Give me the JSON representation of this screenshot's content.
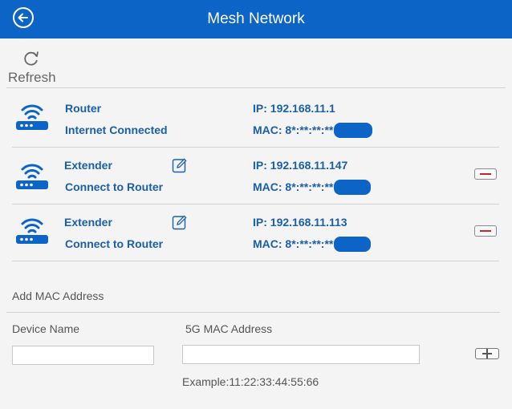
{
  "header": {
    "title": "Mesh Network"
  },
  "toolbar": {
    "refresh_label": "Refresh"
  },
  "devices": [
    {
      "type": "Router",
      "status": "Internet Connected",
      "ip": "IP: 192.168.11.1",
      "mac": "MAC: 8*:**:**:**:"
    },
    {
      "type": "Extender",
      "status": "Connect to Router",
      "ip": "IP: 192.168.11.147",
      "mac": "MAC: 8*:**:**:**:"
    },
    {
      "type": "Extender",
      "status": "Connect to Router",
      "ip": "IP: 192.168.11.113",
      "mac": "MAC: 8*:**:**:**:"
    }
  ],
  "add_mac": {
    "section_title": "Add MAC Address",
    "device_name_label": "Device Name",
    "mac_label": "5G MAC Address",
    "device_name_value": "",
    "mac_value": "",
    "example": "Example:11:22:33:44:55:66"
  },
  "colors": {
    "header": "#0b64c6",
    "text_accent": "#1a5fa8",
    "remove": "#c62828"
  },
  "icons": {
    "back": "arrow-left-circle-icon",
    "refresh": "refresh-icon",
    "device": "wifi-router-icon",
    "edit": "edit-icon",
    "remove": "minus-icon",
    "add": "plus-icon"
  }
}
